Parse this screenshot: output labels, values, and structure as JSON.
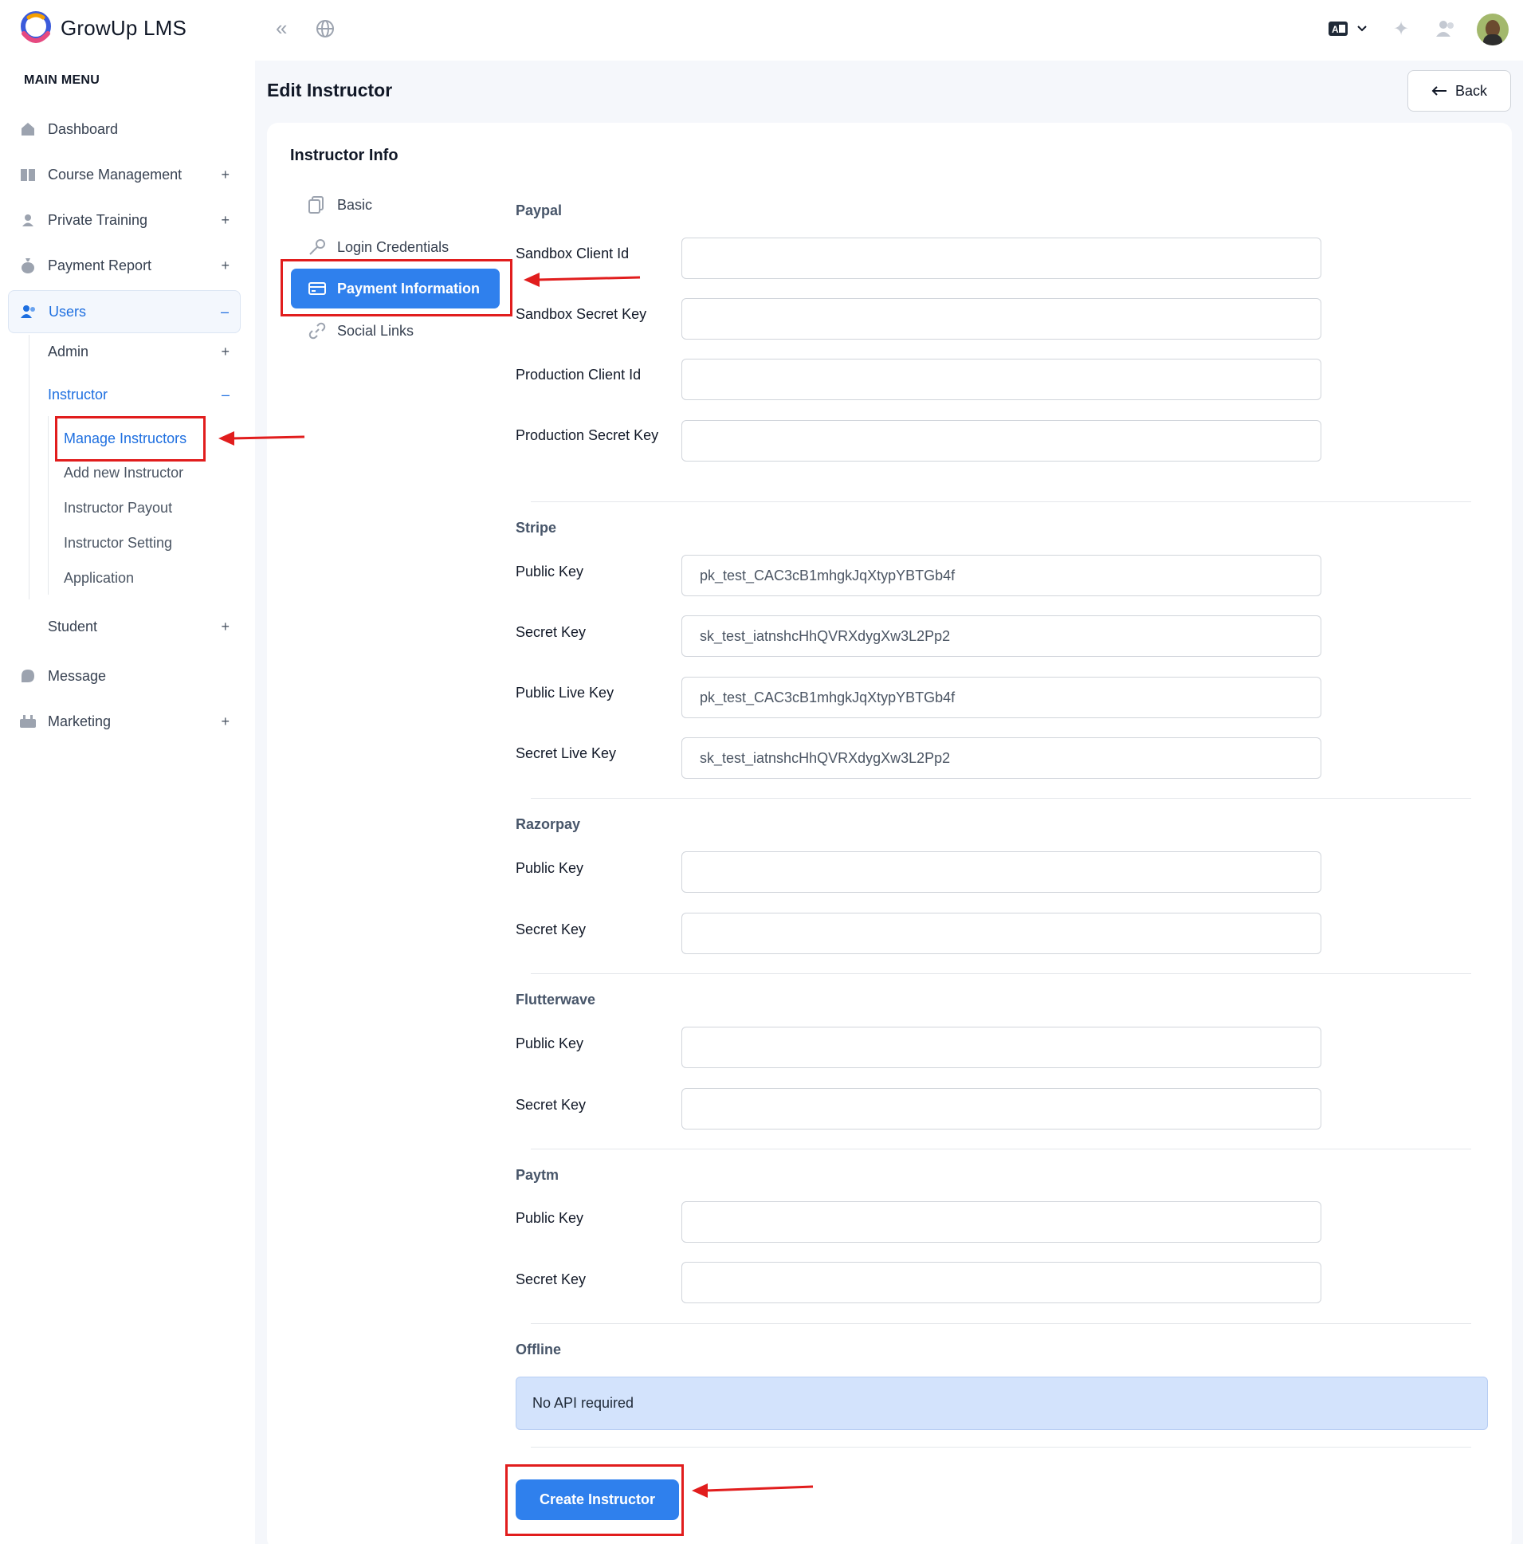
{
  "app": {
    "name": "GrowUp LMS"
  },
  "sidebar": {
    "menu_title": "MAIN MENU",
    "items": [
      {
        "label": "Dashboard",
        "icon": "home-icon"
      },
      {
        "label": "Course Management",
        "icon": "book-icon",
        "toggle": "+"
      },
      {
        "label": "Private Training",
        "icon": "training-icon",
        "toggle": "+"
      },
      {
        "label": "Payment Report",
        "icon": "money-bag-icon",
        "toggle": "+"
      },
      {
        "label": "Users",
        "icon": "users-icon",
        "toggle": "–"
      }
    ],
    "users_sub": [
      {
        "label": "Admin",
        "toggle": "+"
      },
      {
        "label": "Instructor",
        "toggle": "–"
      }
    ],
    "instructor_sub": [
      "Manage Instructors",
      "Add new Instructor",
      "Instructor Payout",
      "Instructor Setting",
      "Application"
    ],
    "student": {
      "label": "Student",
      "toggle": "+"
    },
    "bottom": [
      {
        "label": "Message",
        "icon": "message-icon"
      },
      {
        "label": "Marketing",
        "icon": "marketing-icon",
        "toggle": "+"
      }
    ]
  },
  "page": {
    "title": "Edit Instructor",
    "back_label": "Back"
  },
  "card": {
    "title": "Instructor Info",
    "tabs": [
      {
        "label": "Basic",
        "icon": "copy-icon"
      },
      {
        "label": "Login Credentials",
        "icon": "key-icon"
      },
      {
        "label": "Payment Information",
        "icon": "credit-card-icon"
      },
      {
        "label": "Social Links",
        "icon": "link-icon"
      }
    ]
  },
  "form": {
    "paypal": {
      "title": "Paypal",
      "fields": [
        {
          "label": "Sandbox Client Id",
          "value": ""
        },
        {
          "label": "Sandbox Secret Key",
          "value": ""
        },
        {
          "label": "Production Client Id",
          "value": ""
        },
        {
          "label": "Production Secret Key",
          "value": ""
        }
      ]
    },
    "stripe": {
      "title": "Stripe",
      "fields": [
        {
          "label": "Public Key",
          "value": "pk_test_CAC3cB1mhgkJqXtypYBTGb4f"
        },
        {
          "label": "Secret Key",
          "value": "sk_test_iatnshcHhQVRXdygXw3L2Pp2"
        },
        {
          "label": "Public Live Key",
          "value": "pk_test_CAC3cB1mhgkJqXtypYBTGb4f"
        },
        {
          "label": "Secret Live Key",
          "value": "sk_test_iatnshcHhQVRXdygXw3L2Pp2"
        }
      ]
    },
    "razorpay": {
      "title": "Razorpay",
      "fields": [
        {
          "label": "Public Key",
          "value": ""
        },
        {
          "label": "Secret Key",
          "value": ""
        }
      ]
    },
    "flutterwave": {
      "title": "Flutterwave",
      "fields": [
        {
          "label": "Public Key",
          "value": ""
        },
        {
          "label": "Secret Key",
          "value": ""
        }
      ]
    },
    "paytm": {
      "title": "Paytm",
      "fields": [
        {
          "label": "Public Key",
          "value": ""
        },
        {
          "label": "Secret Key",
          "value": ""
        }
      ]
    },
    "offline": {
      "title": "Offline",
      "note": "No API required"
    },
    "submit_label": "Create Instructor"
  },
  "colors": {
    "primary": "#2f80ed",
    "highlight": "#e11d1d",
    "info_bg": "#d3e3fc"
  }
}
